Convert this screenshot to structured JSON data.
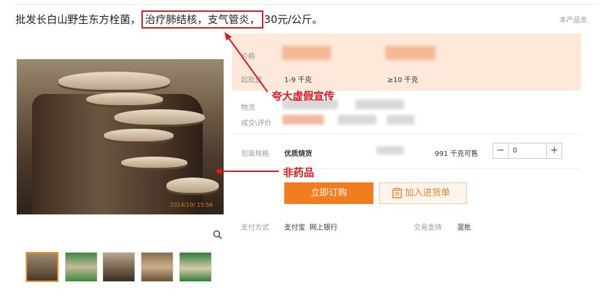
{
  "product": {
    "title_prefix": "批发长白山野生东方栓菌，",
    "title_highlight": "治疗肺结核，支气管炎，",
    "title_suffix": "30元/公斤。",
    "side_note": "本产品支"
  },
  "price_panel": {
    "price_label": "价格",
    "moq_label": "起批量",
    "tier1_qty": "1-9 千克",
    "tier2_qty": "≥10 千克"
  },
  "info": {
    "logistics_label": "物流",
    "deal_label": "成交\\评价",
    "spec_label": "包装规格",
    "spec_value": "优质烧货",
    "stock_text": "991 千克可售",
    "qty_value": "0",
    "qty_minus": "−",
    "qty_plus": "+"
  },
  "buttons": {
    "order": "立即订购",
    "cart": "加入进货单"
  },
  "payment": {
    "label": "支付方式",
    "methods": "支付宝  网上银行",
    "trade_label": "交易支持",
    "trade_value": "混批"
  },
  "photo": {
    "timestamp": "2014/10/  15:56"
  },
  "annotations": {
    "exaggeration": "夸大虚假宣传",
    "not_medicine": "非药品"
  },
  "colors": {
    "accent": "#f27d1e",
    "annotation_red": "#e01a1a",
    "panel_bg": "#fde8d9"
  }
}
